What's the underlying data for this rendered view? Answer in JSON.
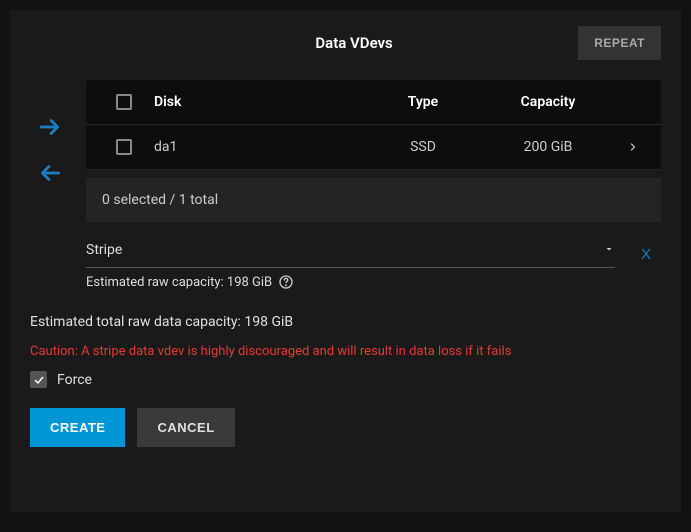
{
  "header": {
    "title": "Data VDevs",
    "repeat_label": "REPEAT"
  },
  "table": {
    "columns": {
      "disk": "Disk",
      "type": "Type",
      "capacity": "Capacity"
    },
    "rows": [
      {
        "disk": "da1",
        "type": "SSD",
        "capacity": "200 GiB"
      }
    ]
  },
  "selection_status": "0 selected / 1 total",
  "vdev": {
    "layout": "Stripe",
    "estimated_label": "Estimated raw capacity: 198 GiB",
    "remove_label": "X"
  },
  "total_capacity": "Estimated total raw data capacity: 198 GiB",
  "caution": "Caution: A stripe data vdev is highly discouraged and will result in data loss if it fails",
  "force_label": "Force",
  "actions": {
    "create": "CREATE",
    "cancel": "CANCEL"
  }
}
